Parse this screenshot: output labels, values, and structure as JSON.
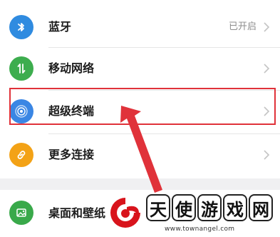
{
  "settings": {
    "items": [
      {
        "label": "蓝牙",
        "value": "已开启",
        "icon": "bluetooth-icon",
        "color": "#2f8be0"
      },
      {
        "label": "移动网络",
        "value": "",
        "icon": "signal-icon",
        "color": "#3dad4e"
      },
      {
        "label": "超级终端",
        "value": "",
        "icon": "super-terminal-icon",
        "color": "#3a86e4"
      },
      {
        "label": "更多连接",
        "value": "",
        "icon": "link-icon",
        "color": "#f3a216"
      },
      {
        "label": "桌面和壁纸",
        "value": "",
        "icon": "image-icon",
        "color": "#39a94a"
      }
    ]
  },
  "annotation": {
    "color": "#e0323a"
  },
  "watermark": {
    "chars": [
      "天",
      "使",
      "游",
      "戏",
      "网"
    ],
    "url": "www.townangel.com"
  }
}
